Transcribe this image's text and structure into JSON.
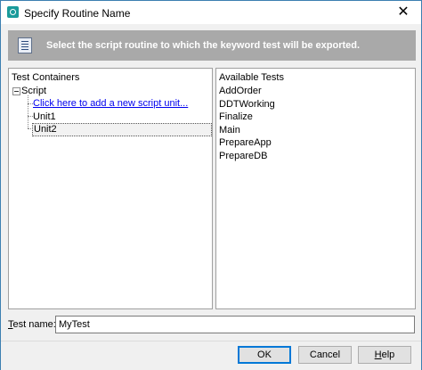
{
  "window": {
    "title": "Specify Routine Name",
    "close_glyph": "✕"
  },
  "banner": {
    "text": "Select the script routine to which the keyword test will be exported.",
    "icon": "script-document-icon"
  },
  "left_panel": {
    "header": "Test Containers",
    "root": {
      "label": "Script",
      "expanded": true
    },
    "items": [
      {
        "label": "Click here to add a new script unit...",
        "kind": "link"
      },
      {
        "label": "Unit1",
        "kind": "item"
      },
      {
        "label": "Unit2",
        "kind": "item",
        "selected": true
      }
    ]
  },
  "right_panel": {
    "header": "Available Tests",
    "tests": [
      "AddOrder",
      "DDTWorking",
      "Finalize",
      "Main",
      "PrepareApp",
      "PrepareDB"
    ]
  },
  "test_name": {
    "label_prefix": "T",
    "label_rest": "est name:",
    "value": "MyTest"
  },
  "buttons": {
    "ok": "OK",
    "cancel": "Cancel",
    "help_prefix": "H",
    "help_rest": "elp"
  },
  "colors": {
    "banner_bg": "#a9a9a9",
    "link": "#0000ee",
    "accent": "#0078d7"
  }
}
